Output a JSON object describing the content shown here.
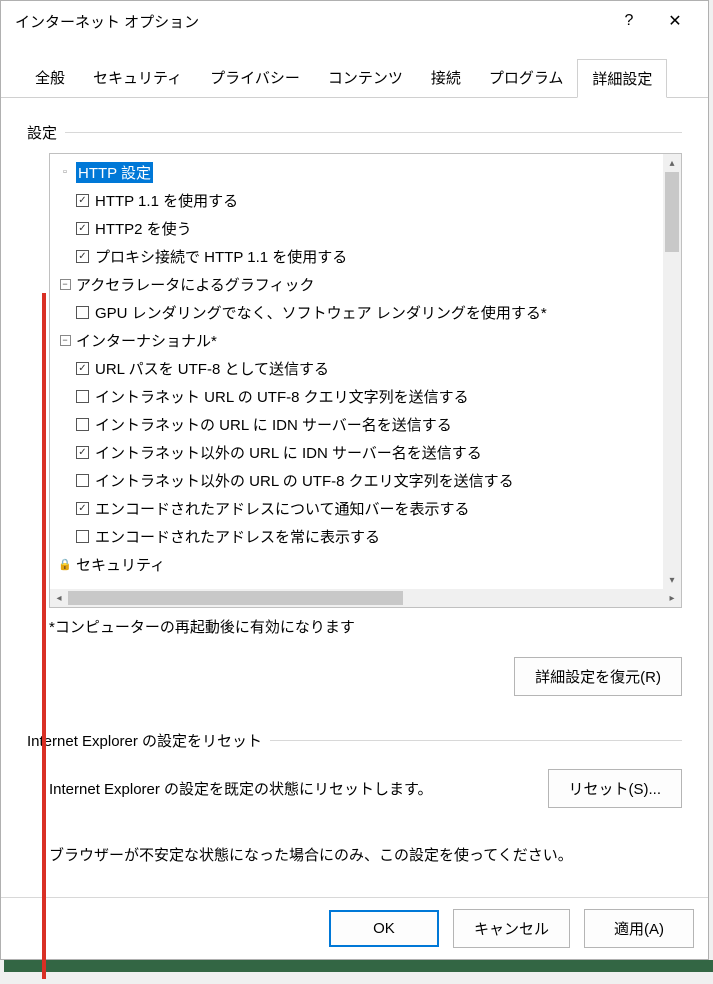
{
  "titlebar": {
    "title": "インターネット オプション",
    "help": "?",
    "close": "✕"
  },
  "tabs": [
    "全般",
    "セキュリティ",
    "プライバシー",
    "コンテンツ",
    "接続",
    "プログラム",
    "詳細設定"
  ],
  "active_tab": 6,
  "settings_label": "設定",
  "tree": [
    {
      "type": "header",
      "icon": "doc",
      "label": "HTTP 設定",
      "highlight": true
    },
    {
      "type": "check",
      "checked": true,
      "label": "HTTP 1.1 を使用する"
    },
    {
      "type": "check",
      "checked": true,
      "label": "HTTP2 を使う"
    },
    {
      "type": "check",
      "checked": true,
      "label": "プロキシ接続で HTTP 1.1 を使用する"
    },
    {
      "type": "header",
      "icon": "collapse",
      "label": "アクセラレータによるグラフィック"
    },
    {
      "type": "check",
      "checked": false,
      "label": "GPU レンダリングでなく、ソフトウェア レンダリングを使用する*"
    },
    {
      "type": "header",
      "icon": "collapse",
      "label": "インターナショナル*"
    },
    {
      "type": "check",
      "checked": true,
      "label": "URL パスを UTF-8 として送信する"
    },
    {
      "type": "check",
      "checked": false,
      "label": "イントラネット URL の UTF-8 クエリ文字列を送信する"
    },
    {
      "type": "check",
      "checked": false,
      "label": "イントラネットの URL に IDN サーバー名を送信する"
    },
    {
      "type": "check",
      "checked": true,
      "label": "イントラネット以外の URL に IDN サーバー名を送信する"
    },
    {
      "type": "check",
      "checked": false,
      "label": "イントラネット以外の URL の UTF-8 クエリ文字列を送信する"
    },
    {
      "type": "check",
      "checked": true,
      "label": "エンコードされたアドレスについて通知バーを表示する"
    },
    {
      "type": "check",
      "checked": false,
      "label": "エンコードされたアドレスを常に表示する"
    },
    {
      "type": "header",
      "icon": "lock",
      "label": "セキュリティ"
    }
  ],
  "restart_note": "*コンピューターの再起動後に有効になります",
  "restore_button": "詳細設定を復元(R)",
  "reset_group_label": "Internet Explorer の設定をリセット",
  "reset_text": "Internet Explorer の設定を既定の状態にリセットします。",
  "reset_button": "リセット(S)...",
  "reset_note": "ブラウザーが不安定な状態になった場合にのみ、この設定を使ってください。",
  "footer": {
    "ok": "OK",
    "cancel": "キャンセル",
    "apply": "適用(A)"
  }
}
